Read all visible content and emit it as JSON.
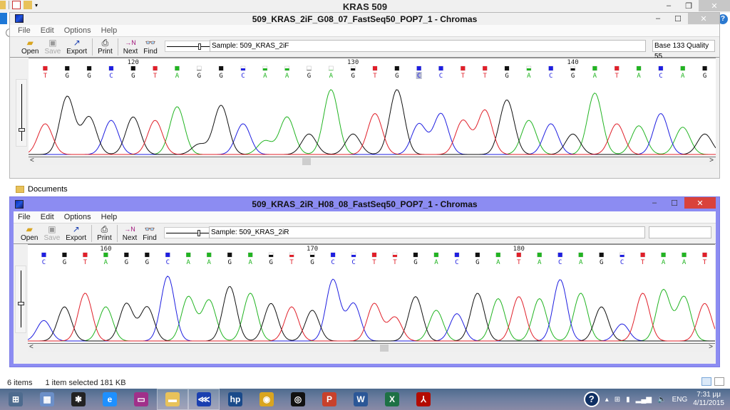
{
  "explorer": {
    "title": "KRAS 509",
    "documents_label": "Documents",
    "status_items": "6 items",
    "status_selected": "1 item selected  181 KB"
  },
  "windows": [
    {
      "title": "509_KRAS_2iF_G08_07_FastSeq50_POP7_1 - Chromas",
      "menu": [
        "File",
        "Edit",
        "Options",
        "Help"
      ],
      "toolbar": {
        "open": "Open",
        "save": "Save",
        "export": "Export",
        "print": "Print",
        "next": "Next",
        "find": "Find"
      },
      "sample": "Sample: 509_KRAS_2iF",
      "base_info": "Base 133  Quality 55",
      "first_base_number": 116,
      "selected_base_number": 133,
      "ruler_labels": [
        {
          "pos": 120,
          "text": "120"
        },
        {
          "pos": 130,
          "text": "130"
        },
        {
          "pos": 140,
          "text": "140"
        }
      ],
      "sequence": [
        "T",
        "G",
        "G",
        "C",
        "G",
        "T",
        "A",
        "G",
        "G",
        "C",
        "A",
        "A",
        "G",
        "A",
        "G",
        "T",
        "G",
        "C",
        "C",
        "T",
        "T",
        "G",
        "A",
        "C",
        "G",
        "A",
        "T",
        "A",
        "C",
        "A",
        "G"
      ],
      "quality": [
        1,
        1,
        1,
        1,
        1,
        1,
        1,
        0.1,
        1,
        0.5,
        0.5,
        0.5,
        0.1,
        0.1,
        0.5,
        1,
        1,
        1,
        1,
        1,
        1,
        1,
        0.5,
        1,
        0.5,
        1,
        1,
        1,
        1,
        1,
        1
      ],
      "peak_heights": [
        0.45,
        0.85,
        0.55,
        0.5,
        0.55,
        0.5,
        0.7,
        0.15,
        0.72,
        0.45,
        0.2,
        0.55,
        0.3,
        0.95,
        0.3,
        0.6,
        0.95,
        0.45,
        0.6,
        0.5,
        0.65,
        0.8,
        0.5,
        0.45,
        0.3,
        0.9,
        0.45,
        0.42,
        0.6,
        0.4,
        0.3
      ],
      "scroll_fraction": 0.4
    },
    {
      "title": "509_KRAS_2iR_H08_08_FastSeq50_POP7_1 - Chromas",
      "menu": [
        "File",
        "Edit",
        "Options",
        "Help"
      ],
      "toolbar": {
        "open": "Open",
        "save": "Save",
        "export": "Export",
        "print": "Print",
        "next": "Next",
        "find": "Find"
      },
      "sample": "Sample: 509_KRAS_2iR",
      "base_info": "",
      "first_base_number": 157,
      "selected_base_number": null,
      "ruler_labels": [
        {
          "pos": 160,
          "text": "160"
        },
        {
          "pos": 170,
          "text": "170"
        },
        {
          "pos": 180,
          "text": "180"
        }
      ],
      "sequence": [
        "C",
        "G",
        "T",
        "A",
        "G",
        "G",
        "C",
        "A",
        "A",
        "G",
        "A",
        "G",
        "T",
        "G",
        "C",
        "C",
        "T",
        "T",
        "G",
        "A",
        "C",
        "G",
        "A",
        "T",
        "A",
        "C",
        "A",
        "G",
        "C",
        "T",
        "A",
        "A",
        "T"
      ],
      "quality": [
        1,
        1,
        1,
        1,
        1,
        1,
        1,
        1,
        1,
        1,
        1,
        0.5,
        0.5,
        0.5,
        1,
        0.5,
        1,
        0.5,
        1,
        1,
        1,
        1,
        1,
        1,
        1,
        1,
        1,
        1,
        0.5,
        1,
        1,
        1,
        1
      ],
      "peak_heights": [
        0.3,
        0.5,
        0.7,
        0.5,
        0.55,
        0.5,
        0.95,
        0.65,
        0.6,
        0.8,
        0.7,
        0.55,
        0.5,
        0.45,
        0.9,
        0.55,
        0.55,
        0.35,
        0.65,
        0.45,
        0.4,
        0.7,
        0.62,
        0.65,
        0.62,
        0.9,
        0.7,
        0.5,
        0.25,
        0.7,
        0.75,
        0.65,
        0.55
      ],
      "scroll_fraction": 0.52
    }
  ],
  "base_colors": {
    "A": "#22b422",
    "C": "#1f1fe0",
    "G": "#111111",
    "T": "#e0202a"
  },
  "taskbar": {
    "apps": [
      {
        "name": "start",
        "icon": "windows-logo-icon"
      },
      {
        "name": "calculator",
        "icon": "calculator-icon"
      },
      {
        "name": "puzzle-app",
        "icon": "puzzle-icon"
      },
      {
        "name": "internet-explorer",
        "icon": "ie-icon"
      },
      {
        "name": "projector-app",
        "icon": "projector-icon"
      },
      {
        "name": "file-explorer",
        "icon": "folder-icon",
        "active": true
      },
      {
        "name": "chromas",
        "icon": "chromas-icon",
        "active": true
      },
      {
        "name": "hp",
        "icon": "hp-icon"
      },
      {
        "name": "chrome",
        "icon": "chrome-icon"
      },
      {
        "name": "media-player",
        "icon": "media-icon"
      },
      {
        "name": "powerpoint",
        "icon": "powerpoint-icon"
      },
      {
        "name": "word",
        "icon": "word-icon"
      },
      {
        "name": "excel",
        "icon": "excel-icon"
      },
      {
        "name": "acrobat",
        "icon": "pdf-icon"
      }
    ],
    "language": "ENG",
    "time": "7:31 μμ",
    "date": "4/11/2015"
  }
}
